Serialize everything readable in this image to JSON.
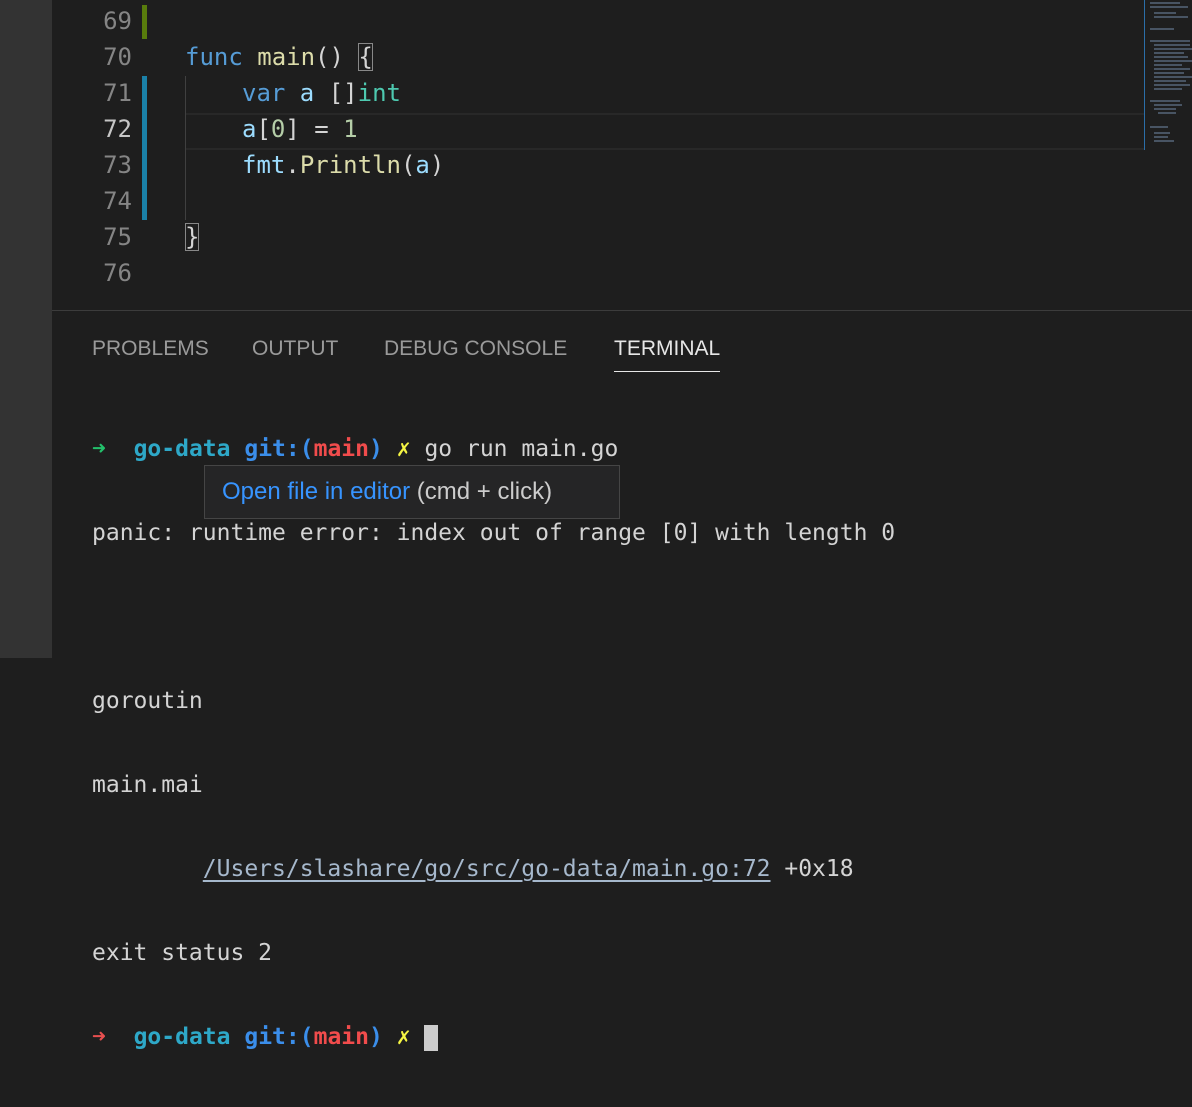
{
  "editor": {
    "lines": [
      {
        "num": "69"
      },
      {
        "num": "70",
        "t1": "func",
        "t2": " ",
        "t3": "main",
        "t4": "() ",
        "t5": "{"
      },
      {
        "num": "71",
        "t1": "var",
        "t2": " a ",
        "t3": "[]",
        "t4": "int"
      },
      {
        "num": "72",
        "t1": "a",
        "t2": "[",
        "t3": "0",
        "t4": "] = ",
        "t5": "1"
      },
      {
        "num": "73",
        "t1": "fmt",
        "t2": ".",
        "t3": "Println",
        "t4": "(",
        "t5": "a",
        "t6": ")"
      },
      {
        "num": "74"
      },
      {
        "num": "75",
        "t1": "}"
      },
      {
        "num": "76"
      }
    ]
  },
  "panel": {
    "tabs": [
      "PROBLEMS",
      "OUTPUT",
      "DEBUG CONSOLE",
      "TERMINAL"
    ],
    "active_tab": "TERMINAL"
  },
  "terminal": {
    "prompt_arrow": "➜",
    "prompt_dir": "go-data",
    "prompt_git": "git:(",
    "prompt_branch": "main",
    "prompt_git_close": ")",
    "prompt_dirty": "✗",
    "command": "go run main.go",
    "panic": "panic: runtime error: index out of range [0] with length 0",
    "goroutine_partial": "goroutin",
    "main_partial": "main.mai",
    "file_link": "/Users/slashare/go/src/go-data/main.go:72",
    "offset": " +0x18",
    "exit": "exit status 2"
  },
  "tooltip": {
    "link": "Open file in editor",
    "hint": " (cmd + click)"
  },
  "colors": {
    "background": "#1e1e1e",
    "modified_gutter": "#1b81a8",
    "added_gutter": "#587c0c",
    "link": "#3794ff"
  }
}
